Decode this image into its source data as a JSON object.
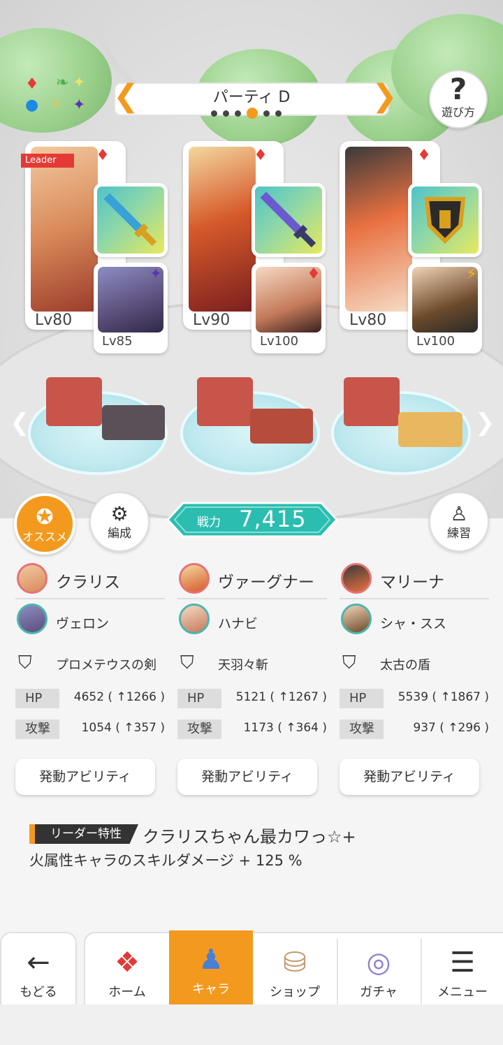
{
  "party": {
    "title": "パーティ D",
    "dots": [
      false,
      false,
      false,
      true,
      false,
      false
    ],
    "help_label": "遊び方"
  },
  "leader_tag": "Leader",
  "characters": [
    {
      "name": "クラリス",
      "level": "Lv80",
      "suit": "♦",
      "sub_name": "ヴェロン",
      "sub_level": "Lv85",
      "sub_suit": "✦",
      "equip": "プロメテウスの剣",
      "hp": "4652 ( ↑1266 )",
      "atk": "1054 ( ↑357 )",
      "ability": "発動アビリティ"
    },
    {
      "name": "ヴァーグナー",
      "level": "Lv90",
      "suit": "♦",
      "sub_name": "ハナビ",
      "sub_level": "Lv100",
      "sub_suit": "♦",
      "equip": "天羽々斬",
      "hp": "5121 ( ↑1267 )",
      "atk": "1173 ( ↑364 )",
      "ability": "発動アビリティ"
    },
    {
      "name": "マリーナ",
      "level": "Lv80",
      "suit": "♦",
      "sub_name": "シャ・スス",
      "sub_level": "Lv100",
      "sub_suit": "⚡",
      "equip": "太古の盾",
      "hp": "5539 ( ↑1867 )",
      "atk": "937 ( ↑296 )",
      "ability": "発動アビリティ"
    }
  ],
  "stats": {
    "hp_label": "HP",
    "atk_label": "攻撃"
  },
  "buttons": {
    "recommend": "オススメ",
    "formation": "編成",
    "practice": "練習"
  },
  "power": {
    "label": "戦力",
    "value": "7,415"
  },
  "leader_skill": {
    "tag": "リーダー特性",
    "name": "クラリスちゃん最カワっ☆+",
    "description": "火属性キャラのスキルダメージ + 125 %"
  },
  "nav": {
    "back": "もどる",
    "home": "ホーム",
    "chara": "キャラ",
    "shop": "ショップ",
    "gacha": "ガチャ",
    "menu": "メニュー"
  },
  "colors": {
    "accent": "#f39a1e",
    "teal": "#2bbdb0",
    "fire": "#e53935"
  }
}
